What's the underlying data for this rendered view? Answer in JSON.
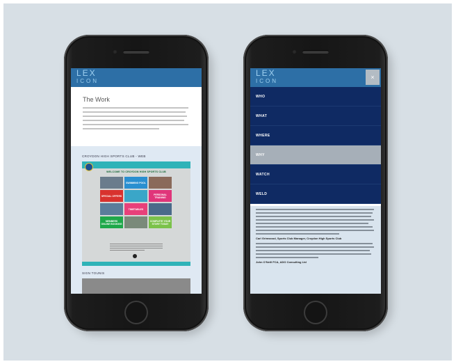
{
  "phone_left": {
    "logo": {
      "line1": "LEX",
      "line2": "ICON"
    },
    "title": "The Work",
    "section_label": "CROYDON HIGH SPORTS CLUB - WEB",
    "mini_site": {
      "welcome": "WELCOME TO CROYDON HIGH SPORTS CLUB",
      "tiles": [
        {
          "label": "",
          "color": "#6a7c8c"
        },
        {
          "label": "SWIMMING POOL",
          "color": "#2a8fd0"
        },
        {
          "label": "",
          "color": "#8a6a5a"
        },
        {
          "label": "SPECIAL OFFERS",
          "color": "#d8322e"
        },
        {
          "label": "",
          "color": "#3aa6c8"
        },
        {
          "label": "PERSONAL TRAINING",
          "color": "#e0357a"
        },
        {
          "label": "",
          "color": "#5a7d9a"
        },
        {
          "label": "TIMETABLES",
          "color": "#e8407a"
        },
        {
          "label": "",
          "color": "#4a6a8a"
        },
        {
          "label": "MEMBERS ONLINE BOOKING",
          "color": "#1fa84a"
        },
        {
          "label": "",
          "color": "#7a8a7a"
        },
        {
          "label": "COMPLETE YOUR STORY TODAY",
          "color": "#7bc24a"
        }
      ]
    },
    "section_label_2": "SIGN TOUNIS"
  },
  "phone_right": {
    "logo": {
      "line1": "LEX",
      "line2": "ICON"
    },
    "close_label": "×",
    "menu": [
      {
        "label": "WHO",
        "active": false
      },
      {
        "label": "WHAT",
        "active": false
      },
      {
        "label": "WHERE",
        "active": false
      },
      {
        "label": "WHY",
        "active": true
      },
      {
        "label": "WATCH",
        "active": false
      },
      {
        "label": "WELD",
        "active": false
      }
    ],
    "testimonials": {
      "author_1": "Carl Grimwood, Sports Club Manager, Croydon High Sports Club",
      "author_2": "John O'Neill FCA, ADO Consulting Ltd"
    }
  }
}
